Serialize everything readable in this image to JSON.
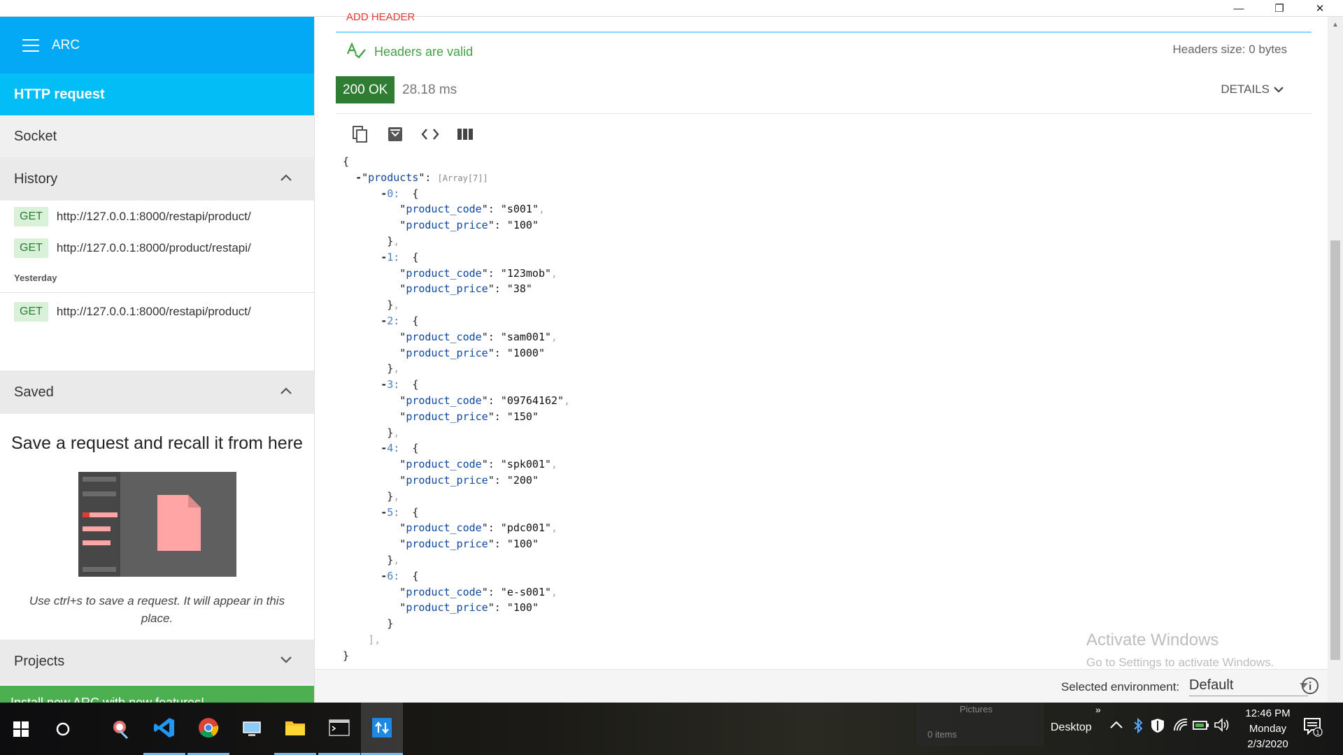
{
  "window": {
    "minimize_glyph": "—",
    "maximize_glyph": "❐",
    "close_glyph": "✕"
  },
  "sidebar": {
    "app_name": "ARC",
    "nav": {
      "http_request": "HTTP request",
      "socket": "Socket"
    },
    "history": {
      "title": "History",
      "items": [
        {
          "method": "GET",
          "url": "http://127.0.0.1:8000/restapi/product/"
        },
        {
          "method": "GET",
          "url": "http://127.0.0.1:8000/product/restapi/"
        }
      ],
      "yesterday_label": "Yesterday",
      "yesterday_items": [
        {
          "method": "GET",
          "url": "http://127.0.0.1:8000/restapi/product/"
        }
      ]
    },
    "saved": {
      "title": "Saved",
      "empty_title": "Save a request and recall it from here",
      "empty_hint": "Use ctrl+s to save a request. It will appear in this place."
    },
    "projects": {
      "title": "Projects"
    },
    "install_banner": "Install new ARC with new features!"
  },
  "response": {
    "add_header_label": "ADD HEADER",
    "headers_valid": "Headers are valid",
    "headers_size": "Headers size: 0 bytes",
    "status": "200 OK",
    "timing": "28.18 ms",
    "details_label": "DETAILS",
    "toolbar": [
      "copy-icon",
      "save-file-icon",
      "code-icon",
      "columns-icon"
    ],
    "json": {
      "root_key": "products",
      "array_label": "[Array[7]]",
      "items": [
        {
          "index": "0:",
          "product_code": "s001",
          "product_price": "100"
        },
        {
          "index": "1:",
          "product_code": "123mob",
          "product_price": "38"
        },
        {
          "index": "2:",
          "product_code": "sam001",
          "product_price": "1000"
        },
        {
          "index": "3:",
          "product_code": "09764162",
          "product_price": "150"
        },
        {
          "index": "4:",
          "product_code": "spk001",
          "product_price": "200"
        },
        {
          "index": "5:",
          "product_code": "pdc001",
          "product_price": "100"
        },
        {
          "index": "6:",
          "product_code": "e-s001",
          "product_price": "100"
        }
      ],
      "field_code": "product_code",
      "field_price": "product_price"
    }
  },
  "watermark": {
    "line1": "Activate Windows",
    "line2": "Go to Settings to activate Windows."
  },
  "environment": {
    "label": "Selected environment:",
    "value": "Default"
  },
  "taskbar": {
    "folder_peek_title": "Pictures",
    "folder_peek_count": "0 items",
    "desktop_label": "Desktop",
    "time": "12:46 PM",
    "day": "Monday",
    "date": "2/3/2020",
    "notification_count": "1"
  },
  "colors": {
    "header_blue": "#03a9f4",
    "status_green": "#2e7d32",
    "banner_green": "#4caf50",
    "valid_green": "#43a047"
  }
}
